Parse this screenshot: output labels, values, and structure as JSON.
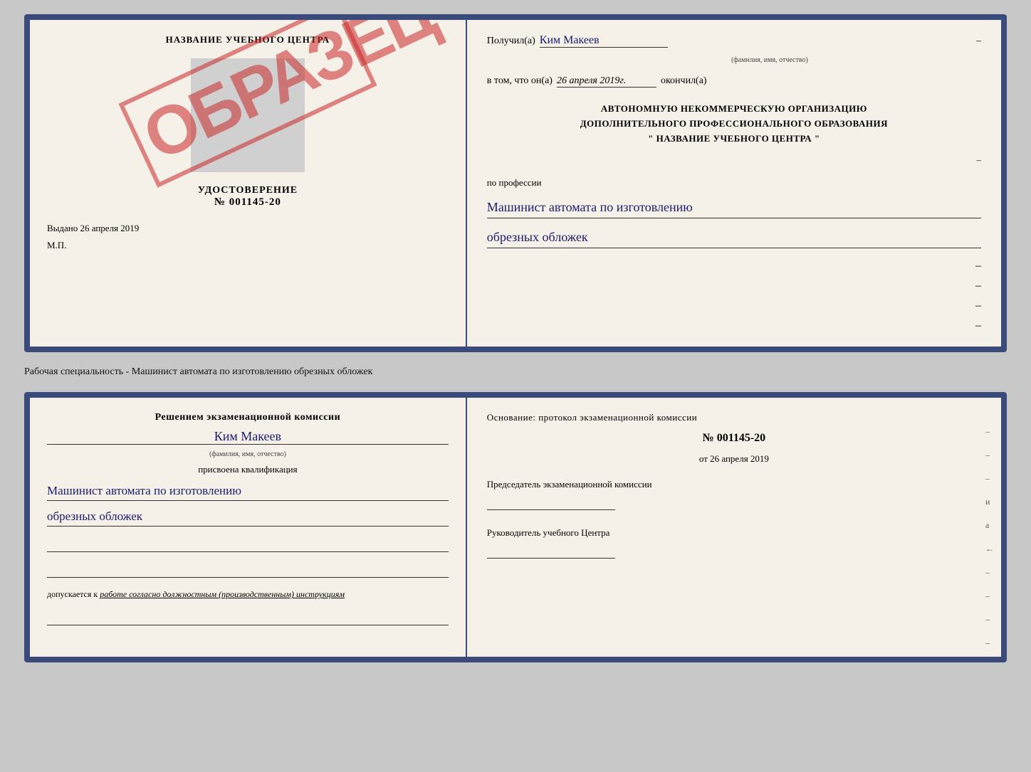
{
  "topDoc": {
    "left": {
      "centerName": "НАЗВАНИЕ УЧЕБНОГО ЦЕНТРА",
      "udostoverenie": "УДОСТОВЕРЕНИЕ",
      "number": "№ 001145-20",
      "vydano": "Выдано",
      "vydanoDate": "26 апреля 2019",
      "mp": "М.П.",
      "obrazec": "ОБРАЗЕЦ"
    },
    "right": {
      "poluchilLabel": "Получил(а)",
      "poluchilValue": "Ким Макеев",
      "fioHint": "(фамилия, имя, отчество)",
      "dash1": "–",
      "vtomLabel": "в том, что он(а)",
      "vtomDate": "26 апреля 2019г.",
      "okonchilLabel": "окончил(а)",
      "mainLine1": "АВТОНОМНУЮ НЕКОММЕРЧЕСКУЮ ОРГАНИЗАЦИЮ",
      "mainLine2": "ДОПОЛНИТЕЛЬНОГО ПРОФЕССИОНАЛЬНОГО ОБРАЗОВАНИЯ",
      "mainLine3": "\"  НАЗВАНИЕ УЧЕБНОГО ЦЕНТРА  \"",
      "dash2": "–",
      "poProfessii": "по профессии",
      "profLine1": "Машинист автомата по изготовлению",
      "profLine2": "обрезных обложек",
      "dashes": [
        "–",
        "–",
        "–",
        "–"
      ]
    }
  },
  "caption": "Рабочая специальность - Машинист автомата по изготовлению обрезных обложек",
  "bottomDoc": {
    "left": {
      "resheniemText": "Решением экзаменационной комиссии",
      "name": "Ким Макеев",
      "fioHint": "(фамилия, имя, отчество)",
      "prisvoena": "присвоена квалификация",
      "kvalifLine1": "Машинист автомата по изготовлению",
      "kvalifLine2": "обрезных обложек",
      "dopuskaetsya": "допускается к",
      "dopuskaetsyaItalic": "работе согласно должностным (производственным) инструкциям"
    },
    "right": {
      "osnovanie": "Основание: протокол экзаменационной комиссии",
      "number": "№  001145-20",
      "otLabel": "от",
      "otDate": "26 апреля 2019",
      "predsedatelTitle": "Председатель экзаменационной комиссии",
      "rukovoditelTitle": "Руководитель учебного Центра",
      "sideDashes": [
        "–",
        "–",
        "–",
        "и",
        "а",
        "←",
        "–",
        "–",
        "–",
        "–"
      ]
    }
  }
}
